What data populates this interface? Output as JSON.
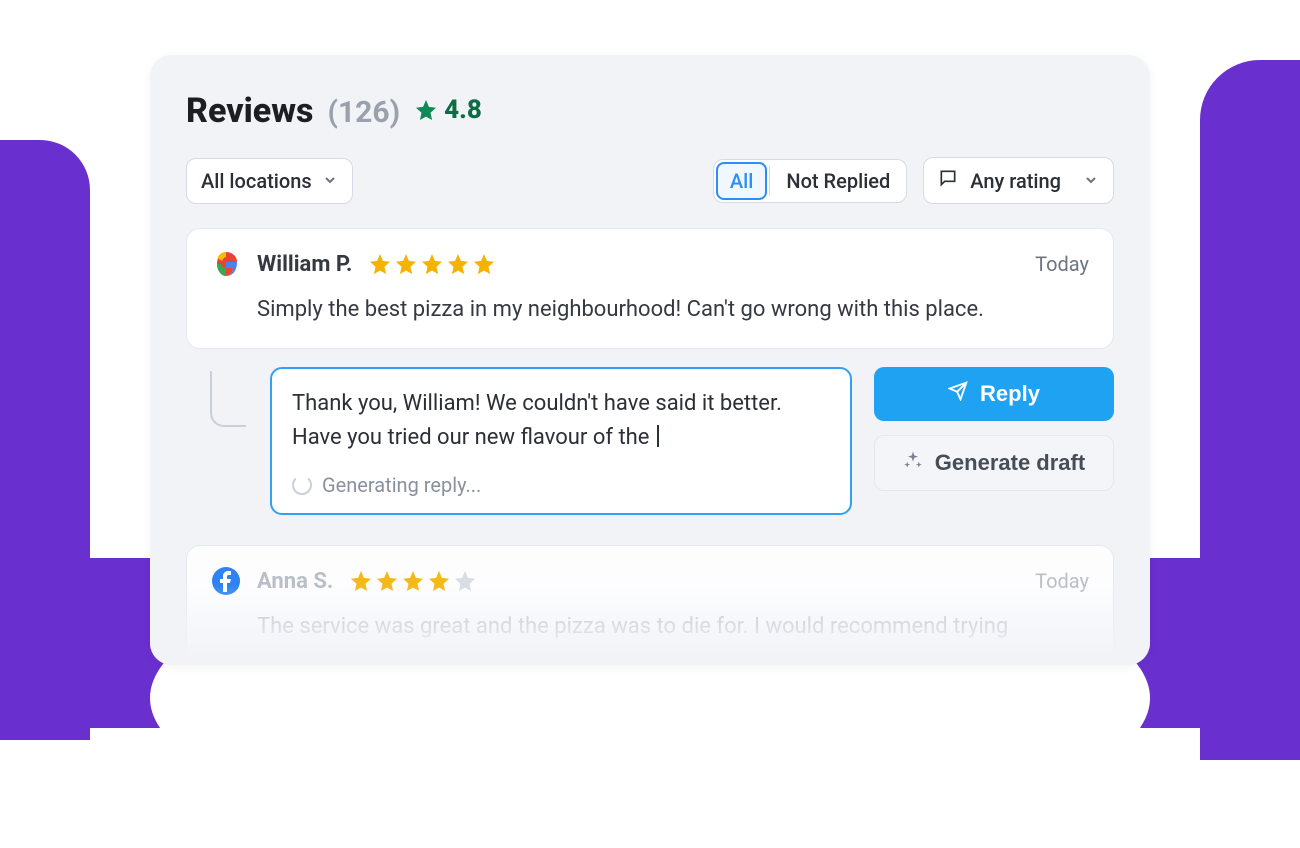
{
  "header": {
    "title": "Reviews",
    "count": "(126)",
    "avg_rating": "4.8"
  },
  "filters": {
    "location": "All locations",
    "tabs": {
      "all": "All",
      "not_replied": "Not Replied"
    },
    "rating": "Any rating"
  },
  "reviews": [
    {
      "source": "google",
      "author": "William P.",
      "stars": 5,
      "time": "Today",
      "body": "Simply the best pizza in my neighbourhood! Can't go wrong with this place."
    },
    {
      "source": "facebook",
      "author": "Anna S.",
      "stars": 4,
      "time": "Today",
      "body": "The service was great and the pizza was to die for. I would recommend trying"
    }
  ],
  "reply": {
    "draft_line1": "Thank you, William! We couldn't have said it better.",
    "draft_line2": "Have you tried our new flavour of the ",
    "generating": "Generating reply...",
    "reply_button": "Reply",
    "generate_button": "Generate draft"
  }
}
